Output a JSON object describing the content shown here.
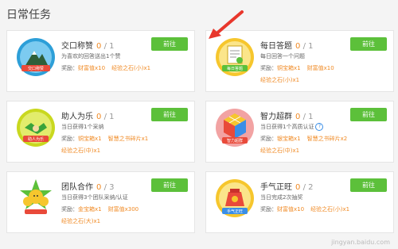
{
  "page_title": "日常任务",
  "button_label": "前往",
  "reward_prefix": "奖励：",
  "tasks": [
    {
      "title": "交口称赞",
      "done": "0",
      "total": "/ 1",
      "desc": "为喜欢的回答送出1个赞",
      "rewards": [
        "财富值x10",
        "经验之石(小)x1"
      ],
      "badge": "mountain-badge-icon",
      "badge_text": "交口称赞"
    },
    {
      "title": "每日答题",
      "done": "0",
      "total": "/ 1",
      "desc": "每日回答一个问题",
      "rewards": [
        "铜宝箱x1",
        "财富值x10"
      ],
      "extra": "经验之石(小)x1",
      "badge": "document-badge-icon",
      "badge_text": "每日答题"
    },
    {
      "title": "助人为乐",
      "done": "0",
      "total": "/ 1",
      "desc": "当日获得1个采纳",
      "rewards": [
        "铜宝箱x1",
        "智慧之书碎片x1"
      ],
      "extra": "经验之石(中)x1",
      "badge": "handshake-badge-icon",
      "badge_text": "助人为乐"
    },
    {
      "title": "智力超群",
      "done": "0",
      "total": "/ 1",
      "desc": "当日获得1个高质认证",
      "rewards": [
        "银宝箱x1",
        "智慧之书碎片x2"
      ],
      "extra": "经验之石(中)x1",
      "badge": "rubik-cube-badge-icon",
      "badge_text": "智力超群"
    },
    {
      "title": "团队合作",
      "done": "0",
      "total": "/ 3",
      "desc": "当日获得3个团队采纳/认证",
      "rewards": [
        "金宝箱x1",
        "财富值x300"
      ],
      "extra": "经验之石(大)x1",
      "badge": "team-badge-icon",
      "badge_text": ""
    },
    {
      "title": "手气正旺",
      "done": "0",
      "total": "/ 2",
      "desc": "当日完成2次抽奖",
      "rewards": [
        "财富值x10",
        "经验之石(小)x1"
      ],
      "badge": "lucky-bag-badge-icon",
      "badge_text": "手气正旺"
    }
  ],
  "watermark": "jingyan.baidu.com",
  "colors": {
    "accent": "#f08a24",
    "button": "#5cc03a",
    "arrow": "#e8372c"
  }
}
